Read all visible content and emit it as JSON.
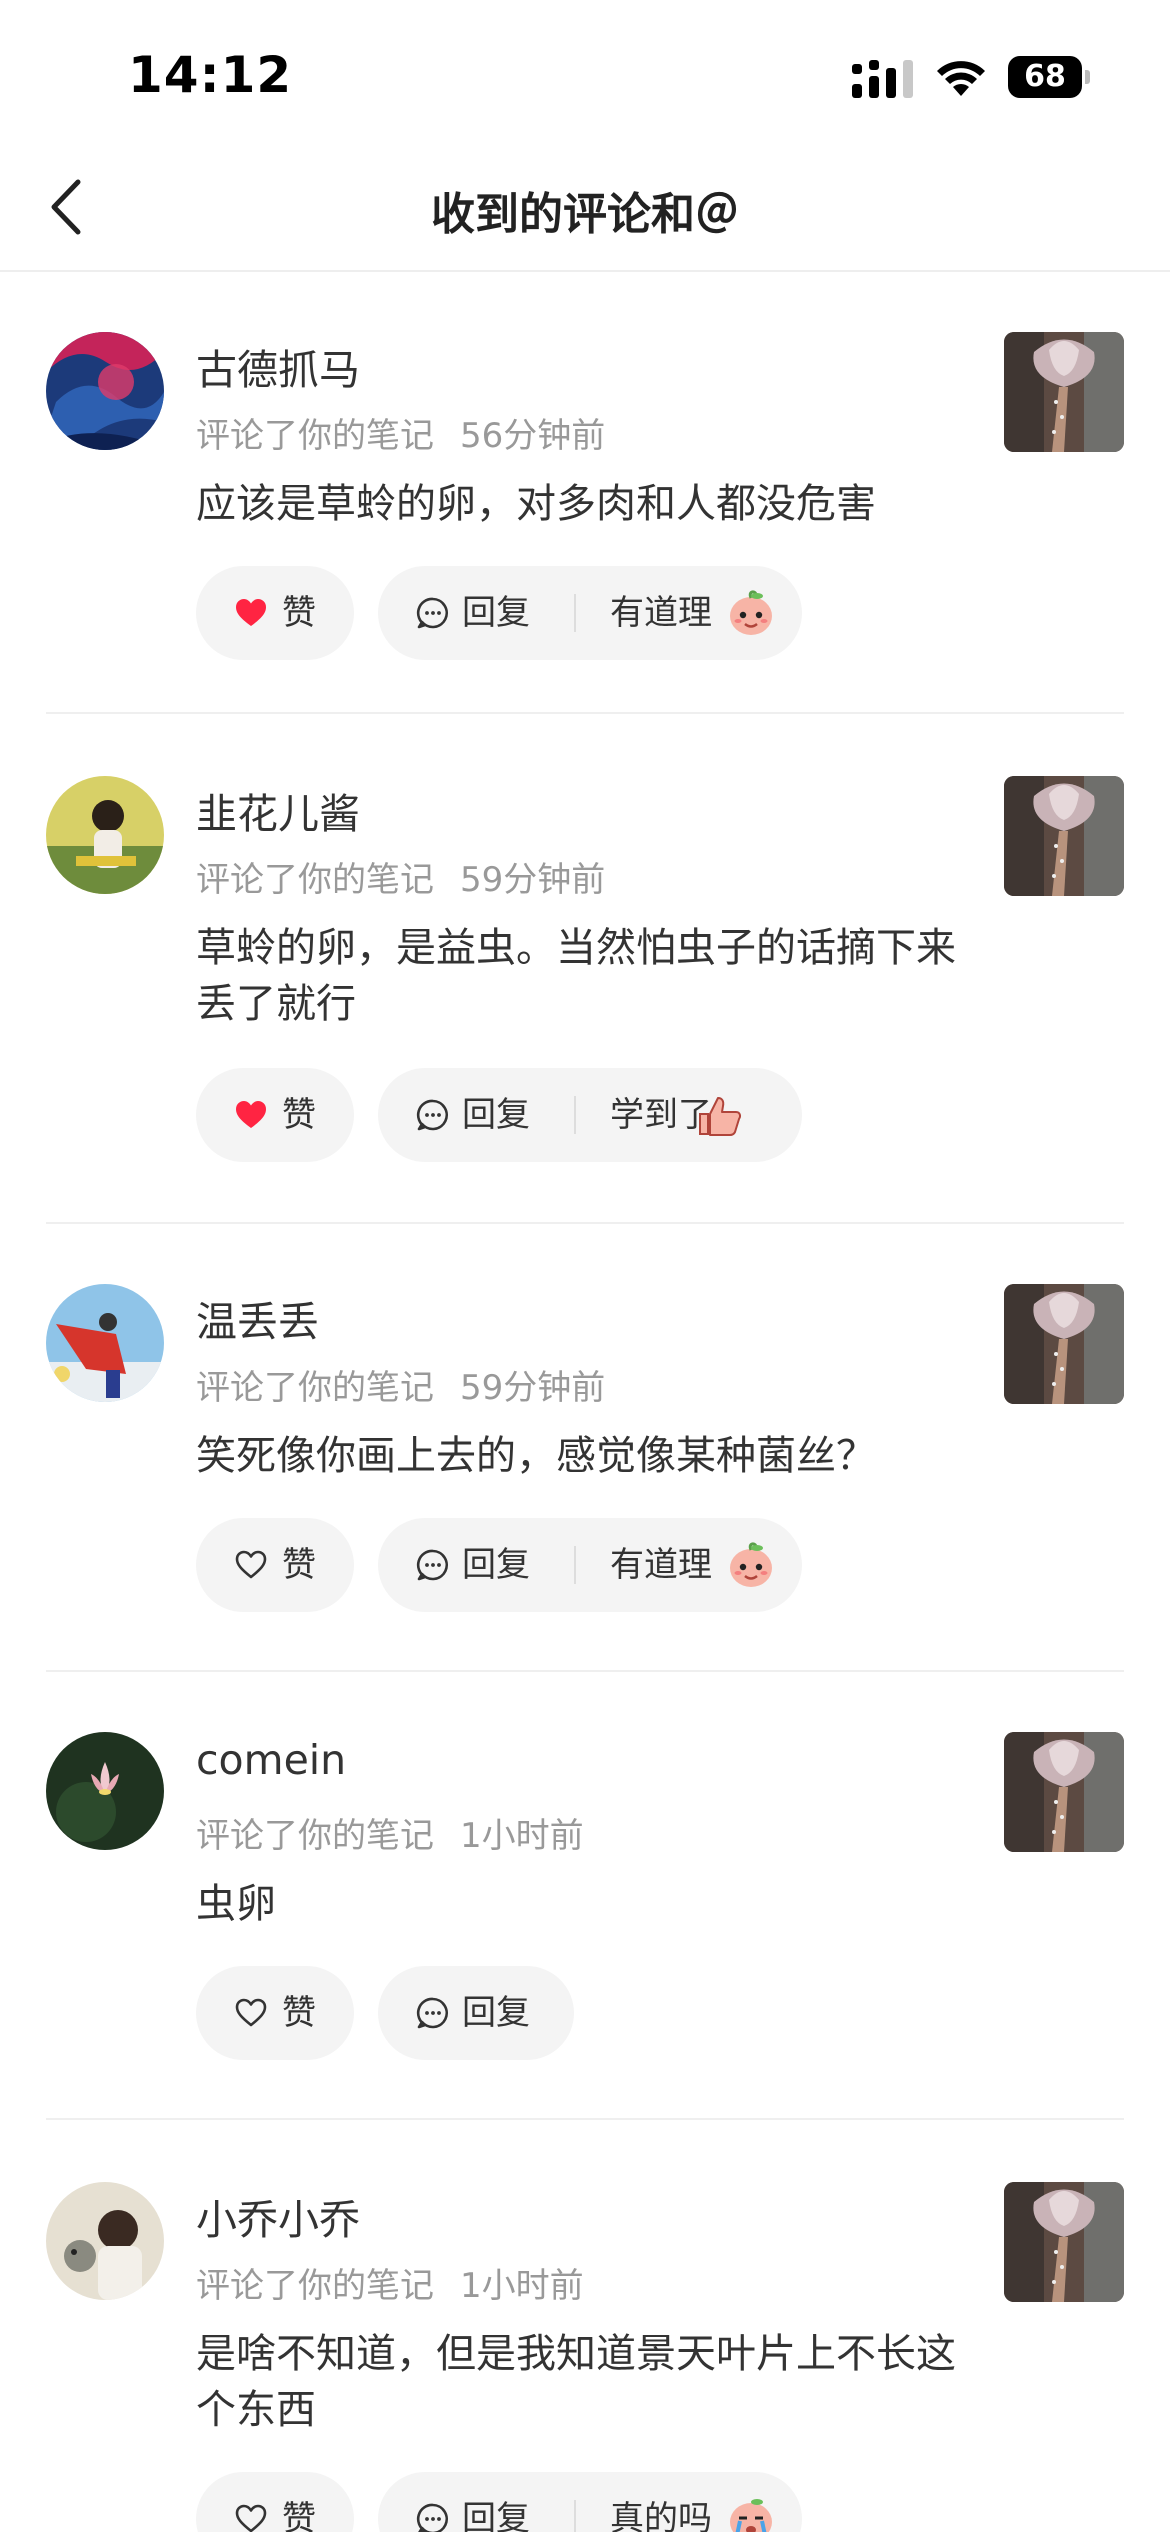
{
  "status_bar": {
    "time": "14:12",
    "battery": "68"
  },
  "nav": {
    "title": "收到的评论和＠"
  },
  "labels": {
    "like": "赞",
    "reply": "回复"
  },
  "comments": [
    {
      "username": "古德抓马",
      "action": "评论了你的笔记",
      "time": "56分钟前",
      "text": "应该是草蛉的卵，对多肉和人都没危害",
      "liked": true,
      "quick_reply": "有道理"
    },
    {
      "username": "韭花儿酱",
      "action": "评论了你的笔记",
      "time": "59分钟前",
      "text": "草蛉的卵，是益虫。当然怕虫子的话摘下来丢了就行",
      "liked": true,
      "quick_reply": "学到了"
    },
    {
      "username": "温丢丢",
      "action": "评论了你的笔记",
      "time": "59分钟前",
      "text": "笑死像你画上去的，感觉像某种菌丝？",
      "liked": false,
      "quick_reply": "有道理"
    },
    {
      "username": "comein",
      "action": "评论了你的笔记",
      "time": "1小时前",
      "text": "虫卵",
      "liked": false,
      "quick_reply": ""
    },
    {
      "username": "小乔小乔",
      "action": "评论了你的笔记",
      "time": "1小时前",
      "text": "是啥不知道，但是我知道景天叶片上不长这个东西",
      "liked": false,
      "quick_reply": "真的吗"
    }
  ],
  "colors": {
    "like_red": "#ff2442",
    "meta_gray": "#999999",
    "pill_bg": "#f4f4f4"
  }
}
